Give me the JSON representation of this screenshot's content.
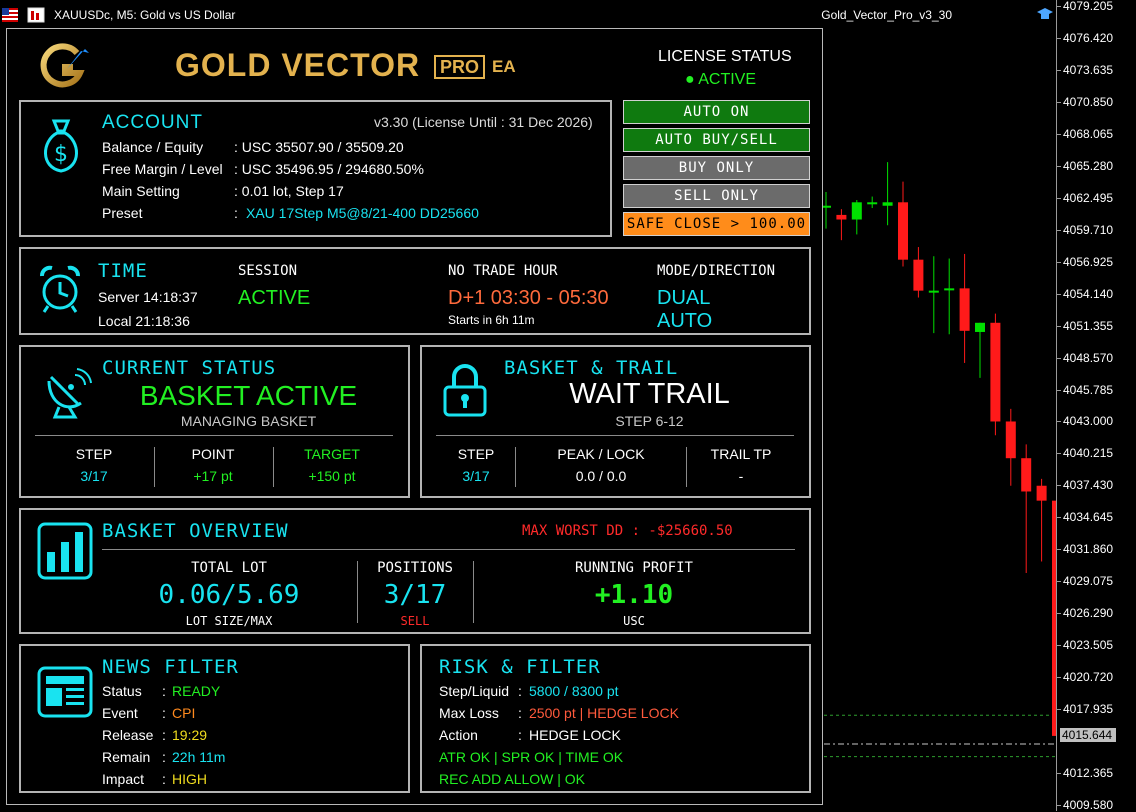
{
  "window": {
    "symbol_title": "XAUUSDc, M5:  Gold vs US Dollar",
    "ea_name": "Gold_Vector_Pro_v3_30"
  },
  "price_axis": {
    "ticks": [
      "4079.205",
      "4076.420",
      "4073.635",
      "4070.850",
      "4068.065",
      "4065.280",
      "4062.495",
      "4059.710",
      "4056.925",
      "4054.140",
      "4051.355",
      "4048.570",
      "4045.785",
      "4043.000",
      "4040.215",
      "4037.430",
      "4034.645",
      "4031.860",
      "4029.075",
      "4026.290",
      "4023.505",
      "4020.720",
      "4017.935",
      "4015.644",
      "4012.365",
      "4009.580"
    ],
    "current_price": "4015.644",
    "current_price_color": "#c0c0c0",
    "bull_color": "#00e000",
    "bear_color": "#ff1a1a"
  },
  "chart_data": {
    "type": "candlestick",
    "title": "",
    "ylim": [
      4009.58,
      4079.205
    ],
    "candles": [
      {
        "o": 4061.8,
        "h": 4063.0,
        "l": 4059.8,
        "c": 4061.8
      },
      {
        "o": 4061.0,
        "h": 4061.5,
        "l": 4058.8,
        "c": 4060.6
      },
      {
        "o": 4060.6,
        "h": 4062.3,
        "l": 4059.3,
        "c": 4062.1
      },
      {
        "o": 4062.1,
        "h": 4062.6,
        "l": 4061.6,
        "c": 4062.1
      },
      {
        "o": 4061.8,
        "h": 4065.6,
        "l": 4060.1,
        "c": 4062.1
      },
      {
        "o": 4062.1,
        "h": 4063.9,
        "l": 4056.5,
        "c": 4057.1
      },
      {
        "o": 4057.1,
        "h": 4058.2,
        "l": 4053.8,
        "c": 4054.4
      },
      {
        "o": 4054.4,
        "h": 4057.4,
        "l": 4050.7,
        "c": 4054.4
      },
      {
        "o": 4054.6,
        "h": 4057.2,
        "l": 4050.6,
        "c": 4054.6
      },
      {
        "o": 4054.6,
        "h": 4057.6,
        "l": 4048.1,
        "c": 4050.9
      },
      {
        "o": 4050.8,
        "h": 4051.6,
        "l": 4046.8,
        "c": 4051.6
      },
      {
        "o": 4051.6,
        "h": 4052.4,
        "l": 4041.8,
        "c": 4043.0
      },
      {
        "o": 4043.0,
        "h": 4044.1,
        "l": 4037.4,
        "c": 4039.8
      },
      {
        "o": 4039.8,
        "h": 4041.0,
        "l": 4029.8,
        "c": 4036.9
      },
      {
        "o": 4037.4,
        "h": 4038.0,
        "l": 4030.8,
        "c": 4036.1
      },
      {
        "o": 4036.1,
        "h": 4037.4,
        "l": 4009.6,
        "c": 4015.6
      }
    ]
  },
  "header": {
    "brand_gold": "GOLD VECTOR",
    "brand_pro": "PRO",
    "brand_ea": "EA",
    "license_label": "LICENSE STATUS",
    "license_value": "● ACTIVE"
  },
  "account": {
    "title": "ACCOUNT",
    "version": "v3.30 (License Until : 31 Dec 2026)",
    "rows": [
      {
        "label": "Balance / Equity",
        "value": ": USC 35507.90 / 35509.20"
      },
      {
        "label": "Free Margin / Level",
        "value": ": USC 35496.95 / 294680.50%"
      },
      {
        "label": "Main Setting",
        "value": ": 0.01 lot, Step 17"
      },
      {
        "label": "Preset",
        "colon": ":",
        "value": "XAU 17Step M5@8/21-400 DD25660"
      }
    ]
  },
  "buttons": {
    "auto_on": "AUTO ON",
    "auto_buy_sell": "AUTO BUY/SELL",
    "buy_only": "BUY ONLY",
    "sell_only": "SELL ONLY",
    "safe_close": "SAFE CLOSE > 100.00"
  },
  "time": {
    "title": "TIME",
    "server": "Server 14:18:37",
    "local": "Local  21:18:36",
    "session_label": "SESSION",
    "session_value": "ACTIVE",
    "no_trade_label": "NO TRADE HOUR",
    "no_trade_value": "D+1 03:30 - 05:30",
    "starts_in": "Starts in 6h 11m",
    "mode_label": "MODE/DIRECTION",
    "mode_value1": "DUAL",
    "mode_value2": "AUTO"
  },
  "current_status": {
    "title": "CURRENT STATUS",
    "main": "BASKET ACTIVE",
    "sub": "MANAGING BASKET",
    "step_label": "STEP",
    "step_value": "3/17",
    "point_label": "POINT",
    "point_value": "+17 pt",
    "target_label": "TARGET",
    "target_value": "+150 pt"
  },
  "basket_trail": {
    "title": "BASKET & TRAIL",
    "main": "WAIT TRAIL",
    "sub": "STEP 6-12",
    "step_label": "STEP",
    "step_value": "3/17",
    "peak_label": "PEAK / LOCK",
    "peak_value": "0.0 / 0.0",
    "tp_label": "TRAIL TP",
    "tp_value": "-"
  },
  "overview": {
    "title": "BASKET OVERVIEW",
    "max_dd": "MAX WORST DD : -$25660.50",
    "lot_label": "TOTAL LOT",
    "lot_value": "0.06/5.69",
    "lot_sub": "LOT SIZE/MAX",
    "pos_label": "POSITIONS",
    "pos_value": "3/17",
    "pos_sub": "SELL",
    "profit_label": "RUNNING PROFIT",
    "profit_value": "+1.10",
    "profit_sub": "USC"
  },
  "news": {
    "title": "NEWS FILTER",
    "rows": [
      {
        "label": "Status",
        "value": "READY"
      },
      {
        "label": "Event",
        "value": "CPI"
      },
      {
        "label": "Release",
        "value": "19:29"
      },
      {
        "label": "Remain",
        "value": "22h 11m"
      },
      {
        "label": "Impact",
        "value": "HIGH"
      }
    ]
  },
  "risk": {
    "title": "RISK & FILTER",
    "rows": [
      {
        "label": "Step/Liquid",
        "value": "5800 / 8300 pt"
      },
      {
        "label": "Max Loss",
        "value": "2500 pt | HEDGE LOCK"
      },
      {
        "label": "Action",
        "value": "HEDGE LOCK"
      }
    ],
    "line4": "ATR OK | SPR OK | TIME OK",
    "line5": "REC ADD ALLOW | OK"
  }
}
